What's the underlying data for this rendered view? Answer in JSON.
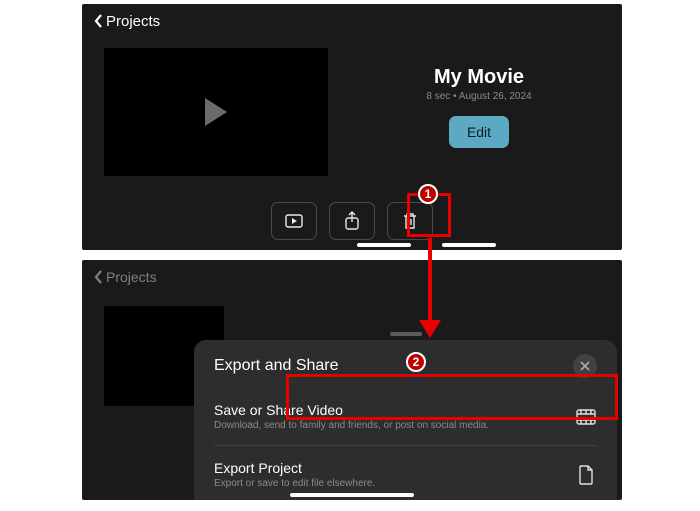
{
  "nav": {
    "back_label": "Projects"
  },
  "movie": {
    "title": "My Movie",
    "subtitle": "8 sec • August 26, 2024",
    "edit_label": "Edit"
  },
  "toolbar": {
    "play_icon": "play",
    "share_icon": "share",
    "trash_icon": "trash"
  },
  "sheet": {
    "title": "Export and Share",
    "items": [
      {
        "title": "Save or Share Video",
        "subtitle": "Download, send to family and friends, or post on social media.",
        "icon": "film"
      },
      {
        "title": "Export Project",
        "subtitle": "Export or save to edit file elsewhere.",
        "icon": "document"
      }
    ]
  },
  "annotations": {
    "step1": "1",
    "step2": "2",
    "highlight_color": "#e60000"
  }
}
